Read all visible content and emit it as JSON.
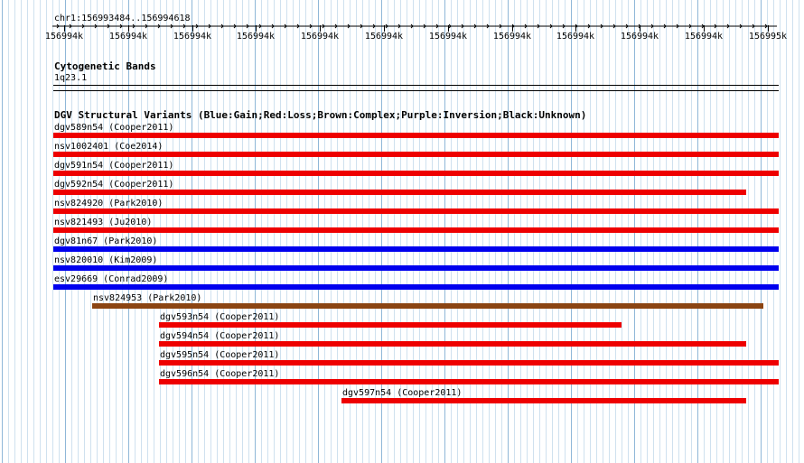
{
  "ruler": {
    "location": "chr1:156993484..156994618",
    "ticks": [
      "156994k",
      "156994k",
      "156994k",
      "156994k",
      "156994k",
      "156994k",
      "156994k",
      "156994k",
      "156994k",
      "156994k",
      "156994k",
      "156995k"
    ]
  },
  "cytoband_track": {
    "title": "Cytogenetic Bands",
    "band": "1q23.1"
  },
  "dgv_track": {
    "title": "DGV Structural Variants (Blue:Gain;Red:Loss;Brown:Complex;Purple:Inversion;Black:Unknown)",
    "colors": {
      "gain": "#0000ee",
      "loss": "#ee0000",
      "complex": "#8b4513"
    },
    "features": [
      {
        "label": "dgv589n54 (Cooper2011)",
        "type": "loss",
        "start": 0.0,
        "end": 1.0
      },
      {
        "label": "nsv1002401 (Coe2014)",
        "type": "loss",
        "start": 0.0,
        "end": 1.0
      },
      {
        "label": "dgv591n54 (Cooper2011)",
        "type": "loss",
        "start": 0.0,
        "end": 1.0
      },
      {
        "label": "dgv592n54 (Cooper2011)",
        "type": "loss",
        "start": 0.0,
        "end": 0.955
      },
      {
        "label": "nsv824920 (Park2010)",
        "type": "loss",
        "start": 0.0,
        "end": 1.0
      },
      {
        "label": "nsv821493 (Ju2010)",
        "type": "loss",
        "start": 0.0,
        "end": 1.0
      },
      {
        "label": "dgv81n67 (Park2010)",
        "type": "gain",
        "start": 0.0,
        "end": 1.0
      },
      {
        "label": "nsv820010 (Kim2009)",
        "type": "gain",
        "start": 0.0,
        "end": 1.0
      },
      {
        "label": "esv29669 (Conrad2009)",
        "type": "gain",
        "start": 0.0,
        "end": 1.0
      },
      {
        "label": "nsv824953 (Park2010)",
        "type": "complex",
        "start": 0.053,
        "end": 0.978
      },
      {
        "label": "dgv593n54 (Cooper2011)",
        "type": "loss",
        "start": 0.146,
        "end": 0.784
      },
      {
        "label": "dgv594n54 (Cooper2011)",
        "type": "loss",
        "start": 0.146,
        "end": 0.955
      },
      {
        "label": "dgv595n54 (Cooper2011)",
        "type": "loss",
        "start": 0.146,
        "end": 1.0
      },
      {
        "label": "dgv596n54 (Cooper2011)",
        "type": "loss",
        "start": 0.146,
        "end": 1.0
      },
      {
        "label": "dgv597n54 (Cooper2011)",
        "type": "loss",
        "start": 0.397,
        "end": 0.955
      }
    ]
  }
}
